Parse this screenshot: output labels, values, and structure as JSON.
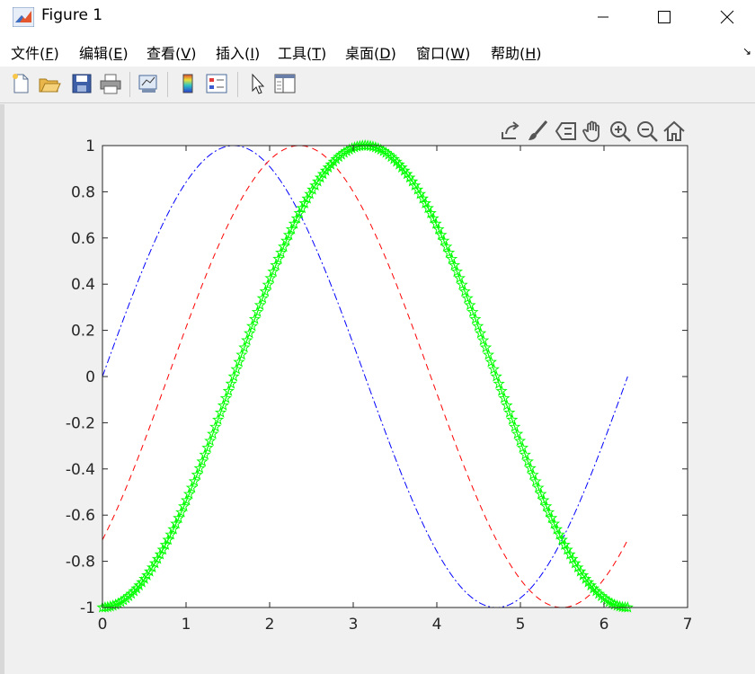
{
  "window": {
    "title": "Figure 1"
  },
  "menu": [
    {
      "label": "文件(",
      "key": "F",
      "end": ")"
    },
    {
      "label": "编辑(",
      "key": "E",
      "end": ")"
    },
    {
      "label": "查看(",
      "key": "V",
      "end": ")"
    },
    {
      "label": "插入(",
      "key": "I",
      "end": ")"
    },
    {
      "label": "工具(",
      "key": "T",
      "end": ")"
    },
    {
      "label": "桌面(",
      "key": "D",
      "end": ")"
    },
    {
      "label": "窗口(",
      "key": "W",
      "end": ")"
    },
    {
      "label": "帮助(",
      "key": "H",
      "end": ")"
    }
  ],
  "toolbar_icons": [
    "new-figure-icon",
    "open-icon",
    "save-icon",
    "print-icon",
    "link-plot-icon",
    "colorbar-icon",
    "legend-icon",
    "pointer-icon",
    "property-inspector-icon"
  ],
  "axes_toolbar_icons": [
    "export-icon",
    "brush-icon",
    "data-tips-icon",
    "pan-icon",
    "zoom-in-icon",
    "zoom-out-icon",
    "home-icon"
  ],
  "chart_data": {
    "type": "line",
    "xlim": [
      0,
      7
    ],
    "ylim": [
      -1,
      1
    ],
    "xticks": [
      "0",
      "1",
      "2",
      "3",
      "4",
      "5",
      "6",
      "7"
    ],
    "yticks": [
      "-1",
      "-0.8",
      "-0.6",
      "-0.4",
      "-0.2",
      "0",
      "0.2",
      "0.4",
      "0.6",
      "0.8",
      "1"
    ],
    "grid": false,
    "x_range": [
      0,
      6.2832
    ],
    "series": [
      {
        "function": "sin(x)",
        "color": "#0000ff",
        "style": "dash-dot"
      },
      {
        "function": "sin(x - pi/4)",
        "color": "#ff0000",
        "style": "dashed"
      },
      {
        "function": "sin(x - pi/2)",
        "color": "#00ff00",
        "style": "solid",
        "marker": "pentagram"
      }
    ]
  }
}
